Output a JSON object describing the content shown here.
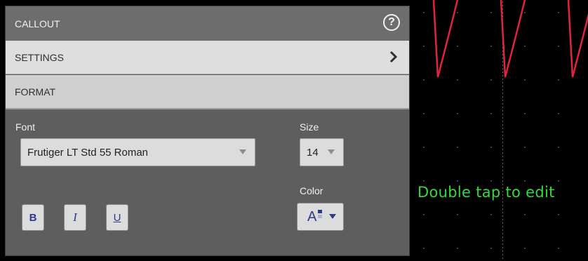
{
  "callout_text": "Double tap to edit",
  "panel": {
    "title": "CALLOUT",
    "help_label": "?",
    "settings_label": "SETTINGS",
    "format_label": "FORMAT",
    "font_label": "Font",
    "font_value": "Frutiger LT Std 55 Roman",
    "size_label": "Size",
    "size_value": "14",
    "color_label": "Color",
    "bold_label": "B",
    "italic_label": "I",
    "underline_label": "U",
    "color_glyph": "A"
  },
  "colors": {
    "waveform": "#e0243c",
    "callout_text": "#35d93a",
    "grid": "#6a6a6a"
  }
}
